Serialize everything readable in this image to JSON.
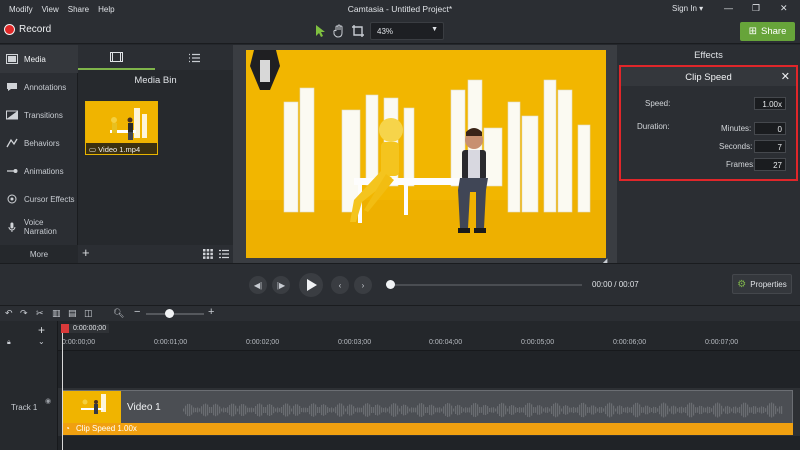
{
  "app": {
    "window_title": "Camtasia - Untitled Project*",
    "menu": [
      "Modify",
      "View",
      "Share",
      "Help"
    ],
    "sign_in": "Sign In",
    "record_label": "Record",
    "share_label": "Share",
    "zoom_value": "43%"
  },
  "colors": {
    "accent_green": "#67a43a",
    "record_red": "#e02828",
    "highlight_red": "#e0262a",
    "speed_orange": "#f0a010",
    "video_yellow": "#f0b400"
  },
  "sidebar": {
    "items": [
      {
        "label": "Media",
        "icon": "film-icon",
        "active": true
      },
      {
        "label": "Annotations",
        "icon": "annotation-icon",
        "active": false
      },
      {
        "label": "Transitions",
        "icon": "transition-icon",
        "active": false
      },
      {
        "label": "Behaviors",
        "icon": "behavior-icon",
        "active": false
      },
      {
        "label": "Animations",
        "icon": "animation-icon",
        "active": false
      },
      {
        "label": "Cursor Effects",
        "icon": "cursor-icon",
        "active": false
      },
      {
        "label": "Voice Narration",
        "icon": "microphone-icon",
        "active": false
      }
    ],
    "more_label": "More"
  },
  "media_bin": {
    "title": "Media Bin",
    "items": [
      {
        "name": "Video 1.mp4"
      }
    ]
  },
  "effects": {
    "header": "Effects",
    "clip_speed": {
      "title": "Clip Speed",
      "speed_label": "Speed:",
      "speed_value": "1.00x",
      "duration_label": "Duration:",
      "minutes_label": "Minutes:",
      "minutes_value": "0",
      "seconds_label": "Seconds:",
      "seconds_value": "7",
      "frames_label": "Frames:",
      "frames_value": "27"
    }
  },
  "playback": {
    "current_time": "00:00",
    "separator": "/",
    "total_time": "00:07",
    "properties_label": "Properties",
    "progress": 0
  },
  "timeline": {
    "playhead_time": "0:00:00;00",
    "ticks": [
      "0:00:00;00",
      "0:00:01;00",
      "0:00:02;00",
      "0:00:03;00",
      "0:00:04;00",
      "0:00:05;00",
      "0:00:06;00",
      "0:00:07;00"
    ],
    "track_name": "Track 1",
    "clip_label": "Video 1",
    "speed_label": "Clip Speed 1.00x"
  }
}
